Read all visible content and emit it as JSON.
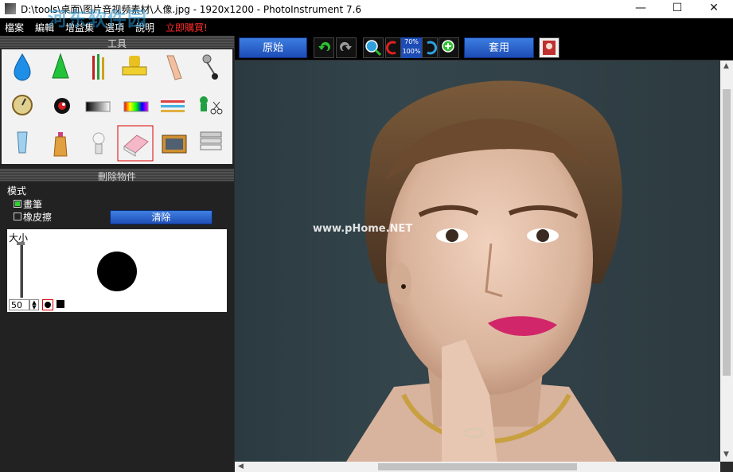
{
  "window": {
    "title": "D:\\tools\\桌面\\图片音视频素材\\人像.jpg - 1920x1200 - PhotoInstrument 7.6",
    "minimize": "—",
    "maximize": "☐",
    "close": "✕",
    "watermark": "河东软件园",
    "watermark_url": "www.pc0359.cn"
  },
  "menu": [
    "檔案",
    "編輯",
    "增益集",
    "選項",
    "說明",
    "立即購買!"
  ],
  "tools_panel": {
    "title": "工具",
    "icons": [
      "water-drop-icon",
      "cone-icon",
      "brushes-icon",
      "stamp-icon",
      "finger-smudge-icon",
      "pin-icon",
      "clock-icon",
      "eye-icon",
      "gradient-bar-icon",
      "rainbow-bar-icon",
      "color-lines-icon",
      "scissors-clone-icon",
      "tube-icon",
      "bottle-icon",
      "bulb-icon",
      "eraser-icon",
      "tv-icon",
      "text-layers-icon"
    ],
    "selected": "eraser-icon"
  },
  "remove_panel": {
    "title": "刪除物件",
    "mode_label": "模式",
    "option_brush": "畫筆",
    "option_eraser": "橡皮擦",
    "clear_button": "清除",
    "size_label": "大小",
    "size_value": "50"
  },
  "toolbar": {
    "original_button": "原始",
    "zoom_top": "70%",
    "zoom_bottom": "100%",
    "apply_button": "套用"
  },
  "canvas": {
    "watermark": "www.pHome.NET"
  },
  "colors": {
    "accent_blue": "#1d4cb6",
    "menu_red": "#ff2a2a",
    "selection_red": "#dd0000",
    "radio_green": "#2fd02f"
  }
}
